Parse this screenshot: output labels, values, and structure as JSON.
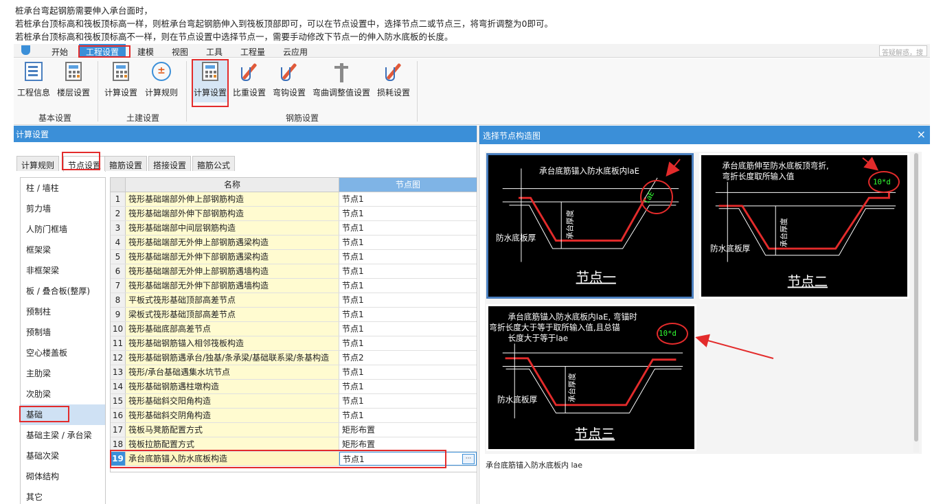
{
  "intro": {
    "line1": "桩承台弯起钢筋需要伸入承台面时，",
    "line2": "若桩承台顶标高和筏板顶标高一样，则桩承台弯起钢筋伸入到筏板顶部即可，可以在节点设置中，选择节点二或节点三，将弯折调整为0即可。",
    "line3": "若桩承台顶标高和筏板顶标高不一样，则在节点设置中选择节点一，需要手动修改下节点一的伸入防水底板的长度。"
  },
  "ribbon_tabs": [
    "开始",
    "工程设置",
    "建模",
    "视图",
    "工具",
    "工程量",
    "云应用"
  ],
  "active_ribbon_tab": "工程设置",
  "search_placeholder": "答疑解惑，搜",
  "ribbon_groups": [
    {
      "name": "基本设置",
      "buttons": [
        {
          "label": "工程信息",
          "icon": "doc-info-icon"
        },
        {
          "label": "楼层设置",
          "icon": "floor-setting-icon"
        }
      ]
    },
    {
      "name": "土建设置",
      "buttons": [
        {
          "label": "计算设置",
          "icon": "calc-setting-icon"
        },
        {
          "label": "计算规则",
          "icon": "calc-rule-icon"
        }
      ]
    },
    {
      "name": "钢筋设置",
      "buttons": [
        {
          "label": "计算设置",
          "icon": "rebar-calc-setting-icon"
        },
        {
          "label": "比重设置",
          "icon": "weight-setting-icon"
        },
        {
          "label": "弯钩设置",
          "icon": "hook-setting-icon"
        },
        {
          "label": "弯曲调整值设置",
          "icon": "bend-adjust-icon"
        },
        {
          "label": "损耗设置",
          "icon": "loss-setting-icon"
        }
      ]
    }
  ],
  "left_panel": {
    "title": "计算设置",
    "tabs": [
      "计算规则",
      "节点设置",
      "箍筋设置",
      "搭接设置",
      "箍筋公式"
    ],
    "active_tab": "节点设置",
    "categories": [
      "柱 / 墙柱",
      "剪力墙",
      "人防门框墙",
      "框架梁",
      "非框架梁",
      "板 / 叠合板(整厚)",
      "预制柱",
      "预制墙",
      "空心楼盖板",
      "主肋梁",
      "次肋梁",
      "基础",
      "基础主梁 / 承台梁",
      "基础次梁",
      "砌体结构",
      "其它"
    ],
    "selected_category": "基础",
    "grid_headers": {
      "name": "名称",
      "node": "节点图"
    },
    "rows": [
      {
        "num": "1",
        "name": "筏形基础端部外伸上部钢筋构造",
        "node": "节点1"
      },
      {
        "num": "2",
        "name": "筏形基础端部外伸下部钢筋构造",
        "node": "节点1"
      },
      {
        "num": "3",
        "name": "筏形基础端部中间层钢筋构造",
        "node": "节点1"
      },
      {
        "num": "4",
        "name": "筏形基础端部无外伸上部钢筋遇梁构造",
        "node": "节点1"
      },
      {
        "num": "5",
        "name": "筏形基础端部无外伸下部钢筋遇梁构造",
        "node": "节点1"
      },
      {
        "num": "6",
        "name": "筏形基础端部无外伸上部钢筋遇墙构造",
        "node": "节点1"
      },
      {
        "num": "7",
        "name": "筏形基础端部无外伸下部钢筋遇墙构造",
        "node": "节点1"
      },
      {
        "num": "8",
        "name": "平板式筏形基础顶部高差节点",
        "node": "节点1"
      },
      {
        "num": "9",
        "name": "梁板式筏形基础顶部高差节点",
        "node": "节点1"
      },
      {
        "num": "10",
        "name": "筏形基础底部高差节点",
        "node": "节点1"
      },
      {
        "num": "11",
        "name": "筏形基础钢筋锚入相邻筏板构造",
        "node": "节点1"
      },
      {
        "num": "12",
        "name": "筏形基础钢筋遇承台/独基/条承梁/基础联系梁/条基构造",
        "node": "节点2"
      },
      {
        "num": "13",
        "name": "筏形/承台基础遇集水坑节点",
        "node": "节点1"
      },
      {
        "num": "14",
        "name": "筏形基础钢筋遇柱墩构造",
        "node": "节点1"
      },
      {
        "num": "15",
        "name": "筏形基础斜交阳角构造",
        "node": "节点1"
      },
      {
        "num": "16",
        "name": "筏形基础斜交阴角构造",
        "node": "节点1"
      },
      {
        "num": "17",
        "name": "筏板马凳筋配置方式",
        "node": "矩形布置"
      },
      {
        "num": "18",
        "name": "筏板拉筋配置方式",
        "node": "矩形布置"
      },
      {
        "num": "19",
        "name": "承台底筋锚入防水底板构造",
        "node": "节点1"
      }
    ],
    "ellipsis": "···"
  },
  "right_panel": {
    "title": "选择节点构造图",
    "close": "×",
    "nodes": [
      {
        "id": "1",
        "caption": "节点一",
        "text": "承台底筋锚入防水底板内laE",
        "anno": "laE",
        "label_left": "防水底板厚",
        "label_mid": "承台厚度"
      },
      {
        "id": "2",
        "caption": "节点二",
        "text1": "承台底筋伸至防水底板顶弯折,",
        "text2": "弯折长度取所输入值",
        "anno": "10*d",
        "label_left": "防水底板厚",
        "label_mid": "承台厚度"
      },
      {
        "id": "3",
        "caption": "节点三",
        "text1": "承台底筋锚入防水底板内laE, 弯锚时",
        "text2": "弯折长度大于等于取所输入值,且总锚",
        "text3": "长度大于等于lae",
        "anno": "10*d",
        "label_left": "防水底板厚",
        "label_mid": "承台厚度"
      }
    ],
    "selected_node": "1",
    "description": "承台底筋锚入防水底板内 lae"
  },
  "colors": {
    "accent": "#3b8fd8",
    "highlight": "#e32b2b",
    "rebar": "#e32b2b",
    "diagram_bg": "#000000",
    "annotation": "#33ff33"
  }
}
